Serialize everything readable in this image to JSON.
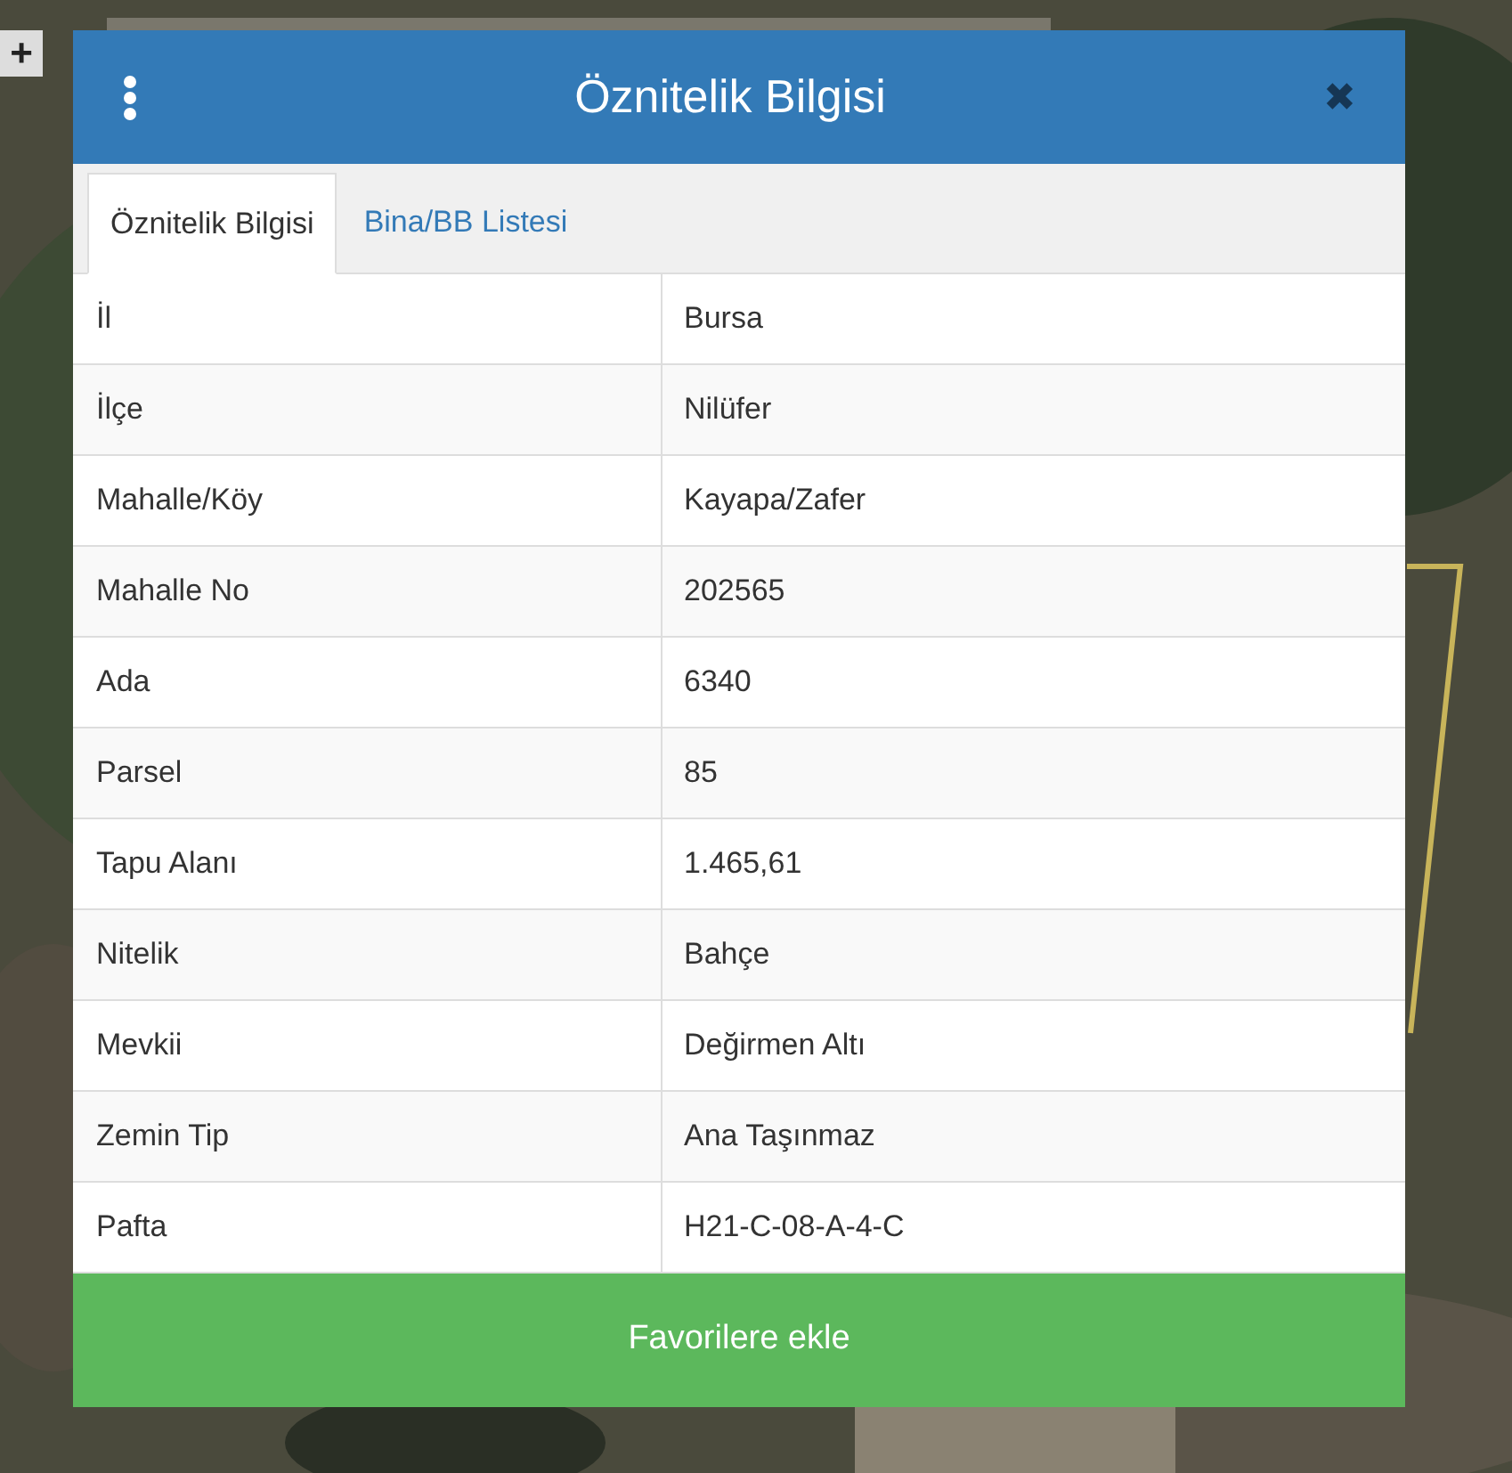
{
  "map": {
    "zoom_in": "+"
  },
  "dialog": {
    "title": "Öznitelik Bilgisi",
    "close": "✖",
    "tabs": [
      {
        "label": "Öznitelik Bilgisi",
        "selected": true
      },
      {
        "label": "Bina/BB Listesi",
        "selected": false
      }
    ],
    "rows": [
      {
        "label": "İl",
        "value": "Bursa"
      },
      {
        "label": "İlçe",
        "value": "Nilüfer"
      },
      {
        "label": "Mahalle/Köy",
        "value": "Kayapa/Zafer"
      },
      {
        "label": "Mahalle No",
        "value": "202565"
      },
      {
        "label": "Ada",
        "value": "6340"
      },
      {
        "label": "Parsel",
        "value": "85"
      },
      {
        "label": "Tapu Alanı",
        "value": "1.465,61"
      },
      {
        "label": "Nitelik",
        "value": "Bahçe"
      },
      {
        "label": "Mevkii",
        "value": "Değirmen Altı"
      },
      {
        "label": "Zemin Tip",
        "value": "Ana Taşınmaz"
      },
      {
        "label": "Pafta",
        "value": "H21-C-08-A-4-C"
      }
    ],
    "action": "Favorilere ekle"
  }
}
